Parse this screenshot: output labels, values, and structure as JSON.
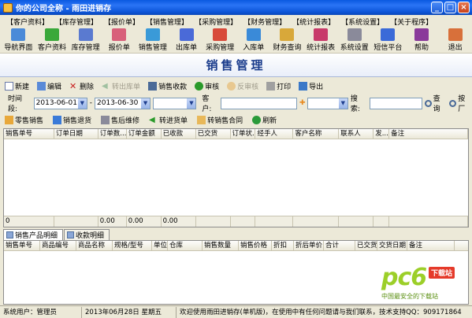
{
  "window": {
    "title": "你的公司全称 - 雨田进销存"
  },
  "menu": [
    "【客户资料】",
    "【库存管理】",
    "【报价单】",
    "【销售管理】",
    "【采购管理】",
    "【财务管理】",
    "【统计报表】",
    "【系统设置】",
    "【关于程序】"
  ],
  "toolbar": [
    {
      "label": "导航界面",
      "icon": "nav-icon",
      "color": "#4a8ad8"
    },
    {
      "label": "客户资料",
      "icon": "customer-icon",
      "color": "#3aa83a"
    },
    {
      "label": "库存管理",
      "icon": "warehouse-icon",
      "color": "#5a7ad0"
    },
    {
      "label": "报价单",
      "icon": "quote-icon",
      "color": "#d8607a"
    },
    {
      "label": "销售管理",
      "icon": "sales-icon",
      "color": "#3a9ad8"
    },
    {
      "label": "出库单",
      "icon": "outbound-icon",
      "color": "#4a6ad8"
    },
    {
      "label": "采购管理",
      "icon": "purchase-icon",
      "color": "#d84a3a"
    },
    {
      "label": "入库单",
      "icon": "inbound-icon",
      "color": "#3a8ad8"
    },
    {
      "label": "财务查询",
      "icon": "finance-icon",
      "color": "#d8a83a"
    },
    {
      "label": "统计报表",
      "icon": "report-icon",
      "color": "#c83a6a"
    },
    {
      "label": "系统设置",
      "icon": "settings-icon",
      "color": "#8a8a9a"
    },
    {
      "label": "短信平台",
      "icon": "sms-icon",
      "color": "#3a6ad8"
    },
    {
      "label": "帮助",
      "icon": "help-icon",
      "color": "#8a3a9a"
    },
    {
      "label": "退出",
      "icon": "exit-icon",
      "color": "#d8703a"
    }
  ],
  "banner": {
    "title": "销售管理"
  },
  "actions": {
    "new": "新建",
    "edit": "编辑",
    "delete": "删除",
    "to_outbound": "转出库单",
    "collect": "销售收款",
    "approve": "审核",
    "unapprove": "反审核",
    "print": "打印",
    "export": "导出"
  },
  "filter": {
    "period_label": "时间段:",
    "date_from": "2013-06-01",
    "dash": "-",
    "date_to": "2013-06-30",
    "customer_label": "客户:",
    "search_label": "搜索:",
    "query": "查询",
    "find": "按厂"
  },
  "subactions": {
    "retail": "零售销售",
    "return": "销售退货",
    "after_sales": "售后维修",
    "to_purchase": "转进货单",
    "to_contract": "转销售合同",
    "refresh": "刷新"
  },
  "top_grid": {
    "columns": [
      "销售单号",
      "订单日期",
      "订单数...",
      "订单金额",
      "已收款",
      "已交货",
      "订单状...",
      "经手人",
      "客户名称",
      "联系人",
      "发...",
      "备注"
    ],
    "summary": [
      "0",
      "",
      "0.00",
      "0.00",
      "0.00",
      "",
      "",
      "",
      "",
      "",
      "",
      ""
    ]
  },
  "tabs": [
    "销售产品明细",
    "收款明细"
  ],
  "bottom_grid": {
    "columns": [
      "销售单号",
      "商品编号",
      "商品名称",
      "规格/型号",
      "单位",
      "仓库",
      "销售数量",
      "销售价格",
      "折扣",
      "折后单价",
      "合计",
      "已交货",
      "交货日期",
      "备注"
    ]
  },
  "status": {
    "user": "系统用户：管理员",
    "date": "2013年06月28日 星期五",
    "message": "欢迎使用雨田进销存(单机版)，在使用中有任何问题请与我们联系，技术支持QQ：909171864"
  },
  "watermark": {
    "logo": "pc6",
    "badge": "下载站",
    "sub": "中国最安全的下载站"
  }
}
